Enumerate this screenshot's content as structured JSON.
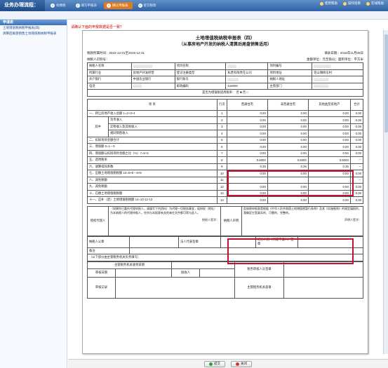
{
  "app": {
    "title": "业务办理流程："
  },
  "steps": [
    {
      "num": "1",
      "label": "扣缴税"
    },
    {
      "num": "2",
      "label": "填写申报表"
    },
    {
      "num": "3",
      "label": "确认申报表"
    },
    {
      "num": "4",
      "label": "提交税款"
    }
  ],
  "toplinks": [
    "使用帮助",
    "操作指南",
    "在线帮助"
  ],
  "sidebar": {
    "header": "申请表",
    "items": [
      "土地增值税纳税申报表(四)",
      "清算后尾盘销售土地增值税纳税申报表"
    ]
  },
  "warning": "请确认下面的申报数据是否一致？",
  "form": {
    "title": "土地增值税纳税申报表（四）",
    "subtitle": "（从事房地产开发的纳税人清算后尾盘销售适用）",
    "period_label": "税款所属时间：",
    "period": "2015-12-01至2015-12-31",
    "fill_date_label": "填表日期：",
    "fill_date": "2016年11月08日",
    "taxpayer_id_label": "纳税人识别号：",
    "unit_label": "金额单位：元至角分；面积单位：平方米",
    "info": {
      "taxpayer_name": "纳税人名称",
      "project_name": "项目名称",
      "project_no": "项目编号",
      "industry": "所属行业",
      "industry_val": "房地产开发经营",
      "reg_type": "登记注册类型",
      "reg_type_val": "私营有限责任公司",
      "project_addr": "项目地址",
      "project_addr_val": "花山镇杨东村",
      "bank": "开户银行",
      "bank_val": "中国农业银行",
      "account": "银行账号",
      "taxpayer_addr": "纳税人地址",
      "phone": "电话",
      "postcode": "邮政编码",
      "postcode_val": "518000",
      "authority": "主管部门",
      "preference": "是否为增值税适用税率：  否 ■  否 □"
    },
    "col_headers": {
      "item": "项 目",
      "line": "行次",
      "general": "普通住宅",
      "nongeneral": "非普通住宅",
      "other": "其他类型房地产",
      "total": "合计"
    },
    "rows": [
      {
        "item": "一、转让房地产收入总额   1=2+3+4",
        "line": "1",
        "v1": "0.00",
        "v2": "0.00",
        "v3": "0.00",
        "v4": "0.00"
      },
      {
        "item": "货币收入",
        "line": "2",
        "v1": "0.00",
        "v2": "0.00",
        "v3": "0.00",
        "v4": "0.00"
      },
      {
        "item": "实物收入及其他收入",
        "line": "3",
        "v1": "0.00",
        "v2": "0.00",
        "v3": "0.00",
        "v4": "0.00"
      },
      {
        "item": "视同销售收入",
        "line": "4",
        "v1": "0.00",
        "v2": "0.00",
        "v3": "0.00",
        "v4": "0.00"
      },
      {
        "item": "二、扣除项目金额合计",
        "line": "5",
        "v1": "0.00",
        "v2": "0.00",
        "v3": "0.00",
        "v4": "0.00"
      },
      {
        "item": "三、增值额   6=1－5",
        "line": "6",
        "v1": "0.00",
        "v2": "0.00",
        "v3": "0.00",
        "v4": "0.00"
      },
      {
        "item": "四、增值额与扣除项目金额之比（%）7=6÷5",
        "line": "7",
        "v1": "0.00",
        "v2": "0.00",
        "v3": "0.00",
        "v4": "0.00"
      },
      {
        "item": "五、适用税率",
        "line": "8",
        "v1": "0.6000",
        "v2": "0.6000",
        "v3": "0.6000",
        "v4": "－"
      },
      {
        "item": "六、速算扣除系数",
        "line": "9",
        "v1": "0.35",
        "v2": "0.35",
        "v3": "0.35",
        "v4": "－"
      },
      {
        "item": "七、应缴土地增值税税额   10=6×8－5×9",
        "line": "10",
        "v1": "0.00",
        "v2": "0.00",
        "v3": "0.00",
        "v4": "0.00"
      },
      {
        "item": "八、减免税额",
        "line": "11",
        "v1": "",
        "v2": "",
        "v3": "",
        "v4": "－"
      },
      {
        "item": "九、减免税额",
        "line": "12",
        "v1": "0.00",
        "v2": "0.00",
        "v3": "0.00",
        "v4": "0.00"
      },
      {
        "item": "十、已缴土地增值税税额",
        "line": "13",
        "v1": "0.00",
        "v2": "0.00",
        "v3": "0.00",
        "v4": "0.00"
      },
      {
        "item": "十一、应补（退）土地增值税税额   14=10-12-13",
        "line": "14",
        "v1": "0.00",
        "v2": "0.00",
        "v3": "0.00",
        "v4": "0.00"
      }
    ],
    "group_label": "其中",
    "decl": {
      "left_head": "授权代理人",
      "left_text": "（如果你已委托代理申报人，请填写下列资料）为代理一切税务事宜，现授权（地址）为本纳税人的代理申报人，任何与本报表有关的来往文件都可寄与此人。",
      "agent_sign": "授权人签字：",
      "right_head": "纳税人声明",
      "right_text": "此纳税申报表是根据《中华人民共和国土地增值税暂行条例》及其《实施细则》的规定填报的，我确定它是真实的、可靠的、完整的。",
      "declarer_sign": "声明人签字："
    },
    "footer": {
      "taxpayer_seal": "纳税人公章",
      "legal_sign": "法人代表签章",
      "agent_seal": "经办人员（代理申报人）签章",
      "remark": "备注",
      "tax_office_note": "（以下部分由主管税务机关负责填写）",
      "received_date": "主管税务机关收到日期",
      "review_date": "审核日期",
      "receiver": "接收人",
      "office_seal": "税务审核人员签章",
      "record": "审核记录",
      "official_seal": "主管税务机关盖章"
    }
  },
  "buttons": {
    "confirm": "提交",
    "cancel": "关闭"
  }
}
